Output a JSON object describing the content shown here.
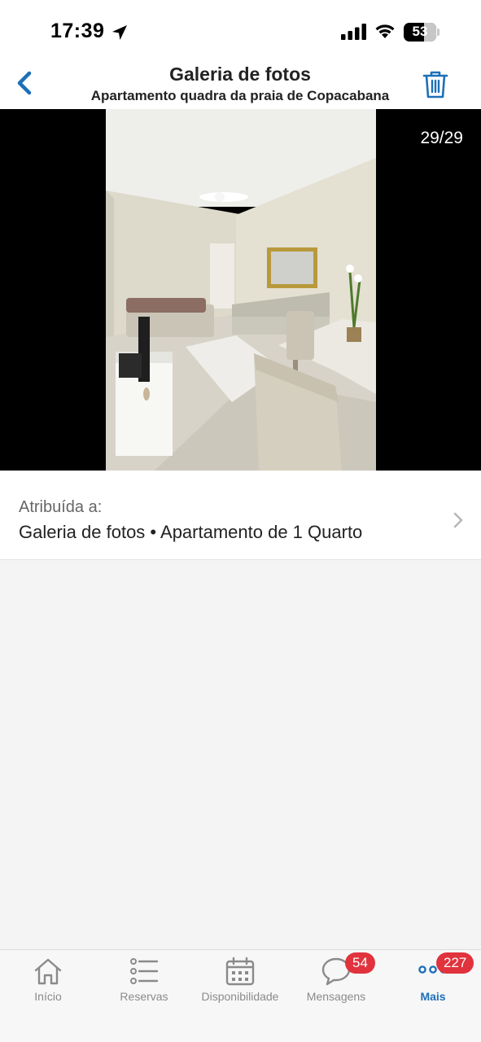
{
  "status_bar": {
    "time": "17:39",
    "battery": "53"
  },
  "header": {
    "title": "Galeria de fotos",
    "subtitle": "Apartamento quadra da praia de Copacabana",
    "back_icon": "chevron-left-icon",
    "delete_icon": "trash-icon"
  },
  "viewer": {
    "counter": "29/29"
  },
  "assigned": {
    "label": "Atribuída a:",
    "value": "Galeria de fotos • Apartamento de 1 Quarto"
  },
  "tabs": [
    {
      "label": "Início",
      "icon": "home-icon"
    },
    {
      "label": "Reservas",
      "icon": "list-icon"
    },
    {
      "label": "Disponibilidade",
      "icon": "calendar-icon"
    },
    {
      "label": "Mensagens",
      "icon": "chat-bubble-icon",
      "badge": "54"
    },
    {
      "label": "Mais",
      "icon": "more-icon",
      "badge": "227",
      "active": true
    }
  ],
  "colors": {
    "accent": "#1d6fb8",
    "badge": "#e0333d",
    "viewer_bg": "#000000"
  }
}
